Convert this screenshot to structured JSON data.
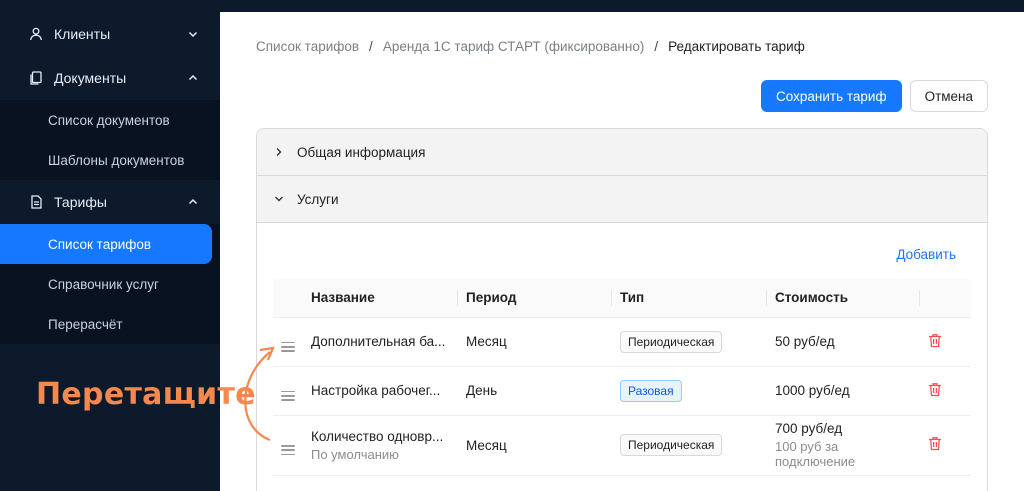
{
  "sidebar": {
    "groups": [
      {
        "label": "Клиенты",
        "icon": "user-icon",
        "expanded": false
      },
      {
        "label": "Документы",
        "icon": "documents-icon",
        "expanded": true,
        "items": [
          "Список документов",
          "Шаблоны документов"
        ]
      },
      {
        "label": "Тарифы",
        "icon": "tariff-icon",
        "expanded": true,
        "items": [
          "Список тарифов",
          "Справочник услуг",
          "Перерасчёт"
        ],
        "active_item": "Список тарифов"
      }
    ]
  },
  "hint": {
    "text": "Перетащите"
  },
  "breadcrumb": {
    "items": [
      "Список тарифов",
      "Аренда 1С тариф СТАРТ (фиксированно)",
      "Редактировать тариф"
    ],
    "separator": "/"
  },
  "actions": {
    "save_label": "Сохранить тариф",
    "cancel_label": "Отмена"
  },
  "panels": {
    "general": {
      "label": "Общая информация",
      "expanded": false
    },
    "services": {
      "label": "Услуги",
      "expanded": true,
      "add_label": "Добавить"
    }
  },
  "table": {
    "columns": [
      "Название",
      "Период",
      "Тип",
      "Стоимость"
    ],
    "rows": [
      {
        "name": "Дополнительная ба...",
        "period": "Месяц",
        "type": "Периодическая",
        "type_kind": "periodic",
        "cost": "50 руб/ед"
      },
      {
        "name": "Настройка рабочег...",
        "period": "День",
        "type": "Разовая",
        "type_kind": "single",
        "cost": "1000 руб/ед"
      },
      {
        "name": "Количество одновр...",
        "name_sub": "По умолчанию",
        "period": "Месяц",
        "type": "Периодическая",
        "type_kind": "periodic",
        "cost": "700 руб/ед",
        "cost_sub": "100 руб за подключение"
      }
    ]
  },
  "colors": {
    "accent": "#1677ff",
    "sidebar_bg": "#0d1a2c",
    "hint": "#f4884d",
    "danger": "#ff4d4f"
  }
}
